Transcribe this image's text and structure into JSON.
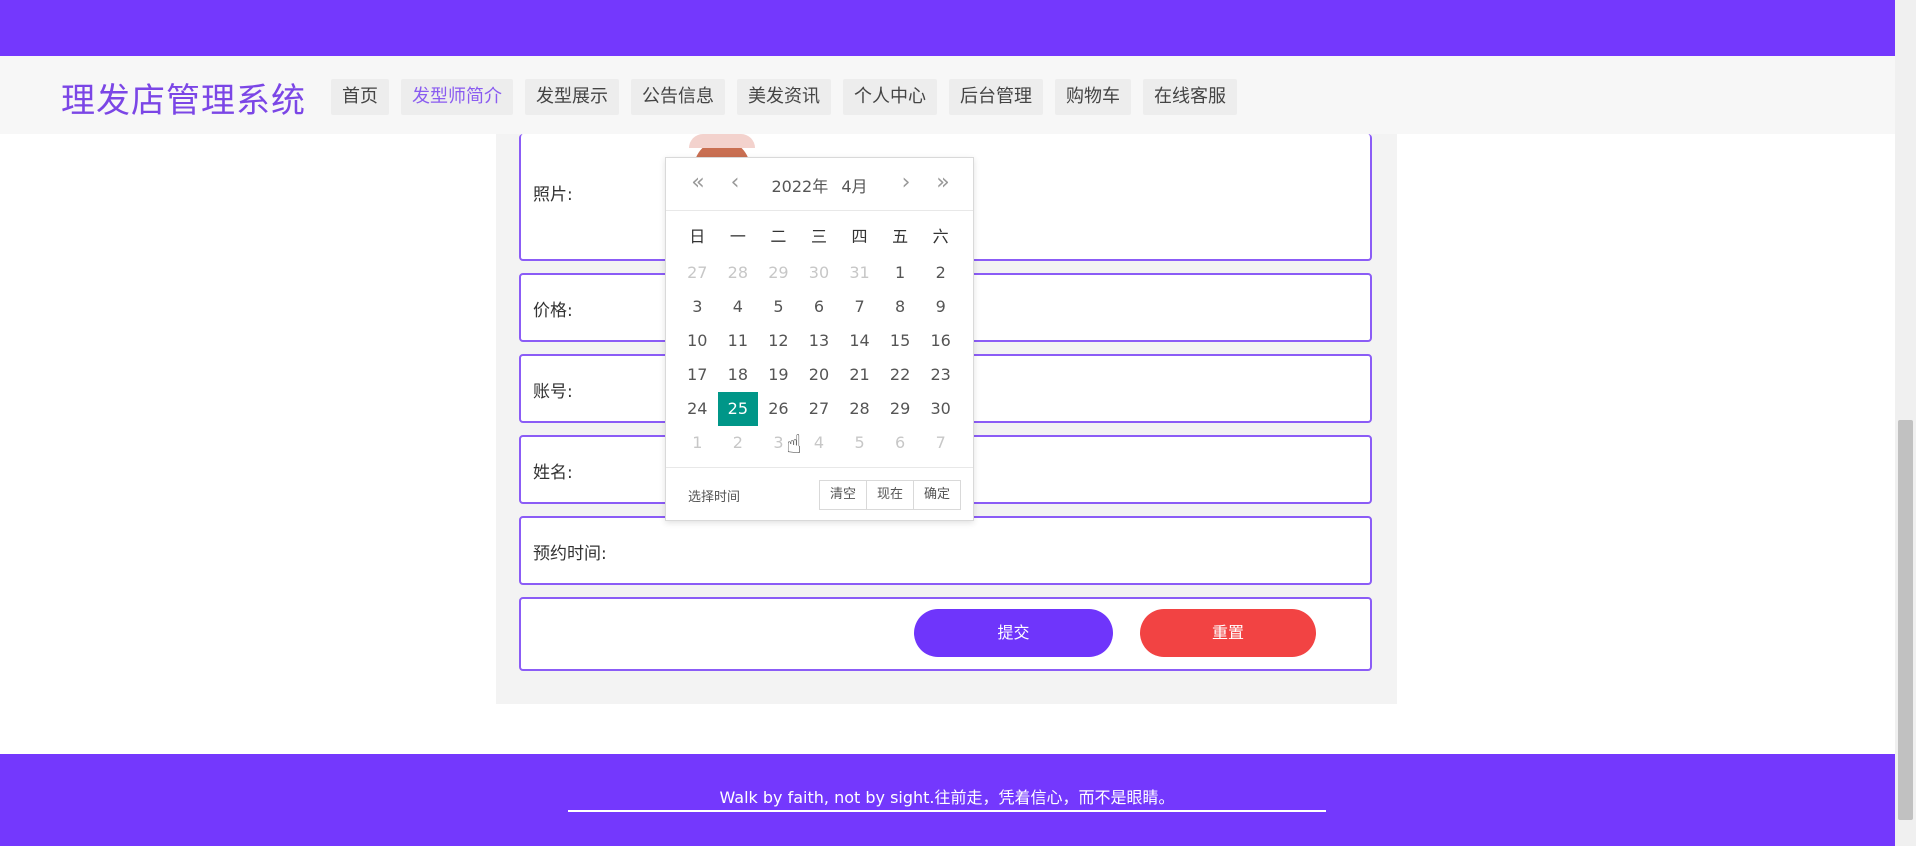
{
  "header": {
    "brand": "理发店管理系统",
    "nav": [
      {
        "label": "首页",
        "active": false
      },
      {
        "label": "发型师简介",
        "active": true
      },
      {
        "label": "发型展示",
        "active": false
      },
      {
        "label": "公告信息",
        "active": false
      },
      {
        "label": "美发资讯",
        "active": false
      },
      {
        "label": "个人中心",
        "active": false
      },
      {
        "label": "后台管理",
        "active": false
      },
      {
        "label": "购物车",
        "active": false
      },
      {
        "label": "在线客服",
        "active": false
      }
    ]
  },
  "form": {
    "photo_label": "照片:",
    "price_label": "价格:",
    "account_label": "账号:",
    "name_label": "姓名:",
    "appointment_label": "预约时间:",
    "submit_label": "提交",
    "reset_label": "重置"
  },
  "datepicker": {
    "year": "2022年",
    "month": "4月",
    "prev_year_icon": "«",
    "prev_month_icon": "‹",
    "next_month_icon": "›",
    "next_year_icon": "»",
    "weekdays": [
      "日",
      "一",
      "二",
      "三",
      "四",
      "五",
      "六"
    ],
    "weeks": [
      [
        {
          "d": "27",
          "m": true
        },
        {
          "d": "28",
          "m": true
        },
        {
          "d": "29",
          "m": true
        },
        {
          "d": "30",
          "m": true
        },
        {
          "d": "31",
          "m": true
        },
        {
          "d": "1"
        },
        {
          "d": "2"
        }
      ],
      [
        {
          "d": "3"
        },
        {
          "d": "4"
        },
        {
          "d": "5"
        },
        {
          "d": "6"
        },
        {
          "d": "7"
        },
        {
          "d": "8"
        },
        {
          "d": "9"
        }
      ],
      [
        {
          "d": "10"
        },
        {
          "d": "11"
        },
        {
          "d": "12"
        },
        {
          "d": "13"
        },
        {
          "d": "14"
        },
        {
          "d": "15"
        },
        {
          "d": "16"
        }
      ],
      [
        {
          "d": "17"
        },
        {
          "d": "18"
        },
        {
          "d": "19"
        },
        {
          "d": "20"
        },
        {
          "d": "21"
        },
        {
          "d": "22"
        },
        {
          "d": "23"
        }
      ],
      [
        {
          "d": "24"
        },
        {
          "d": "25",
          "s": true
        },
        {
          "d": "26"
        },
        {
          "d": "27"
        },
        {
          "d": "28"
        },
        {
          "d": "29"
        },
        {
          "d": "30"
        }
      ],
      [
        {
          "d": "1",
          "m": true
        },
        {
          "d": "2",
          "m": true
        },
        {
          "d": "3",
          "m": true
        },
        {
          "d": "4",
          "m": true
        },
        {
          "d": "5",
          "m": true
        },
        {
          "d": "6",
          "m": true
        },
        {
          "d": "7",
          "m": true
        }
      ]
    ],
    "select_time": "选择时间",
    "clear": "清空",
    "now": "现在",
    "confirm": "确定"
  },
  "footer": {
    "motto": "Walk by faith, not by sight.往前走，凭着信心，而不是眼睛。"
  },
  "colors": {
    "brand_purple": "#7438fd",
    "selected_day": "#009688",
    "reset_red": "#f24343"
  }
}
